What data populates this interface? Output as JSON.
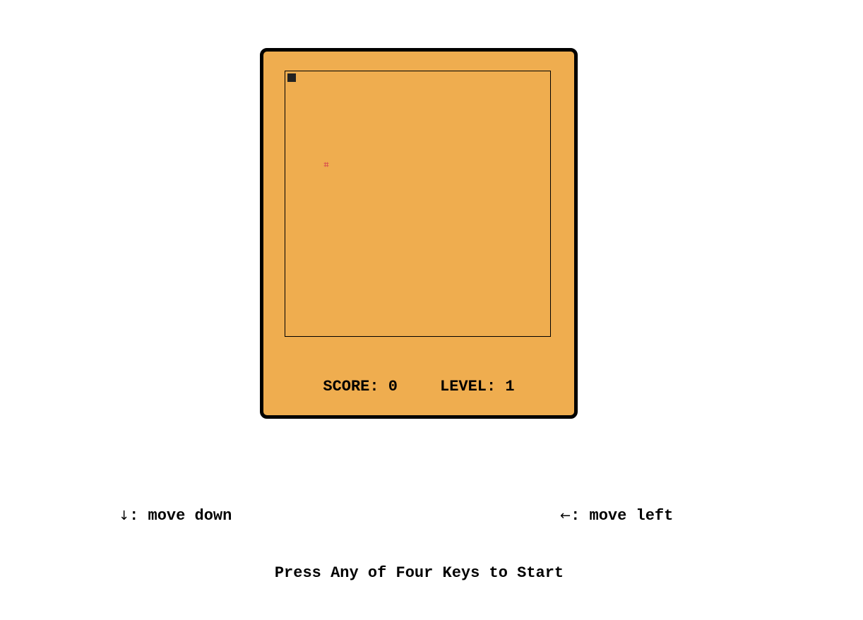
{
  "game": {
    "colors": {
      "console_bg": "#efad4f",
      "snake": "#222222",
      "food": "#d9534f"
    },
    "snake_icon": "square",
    "food_icon": "cross-mark",
    "food_glyph": "⌗"
  },
  "status": {
    "score_label": "SCORE:",
    "score_value": "0",
    "level_label": "LEVEL:",
    "level_value": "1"
  },
  "hints": {
    "down_arrow": "↓",
    "down_text": ": move down",
    "left_arrow": "←",
    "left_text": ": move left"
  },
  "start_message": "Press Any of Four Keys to Start"
}
